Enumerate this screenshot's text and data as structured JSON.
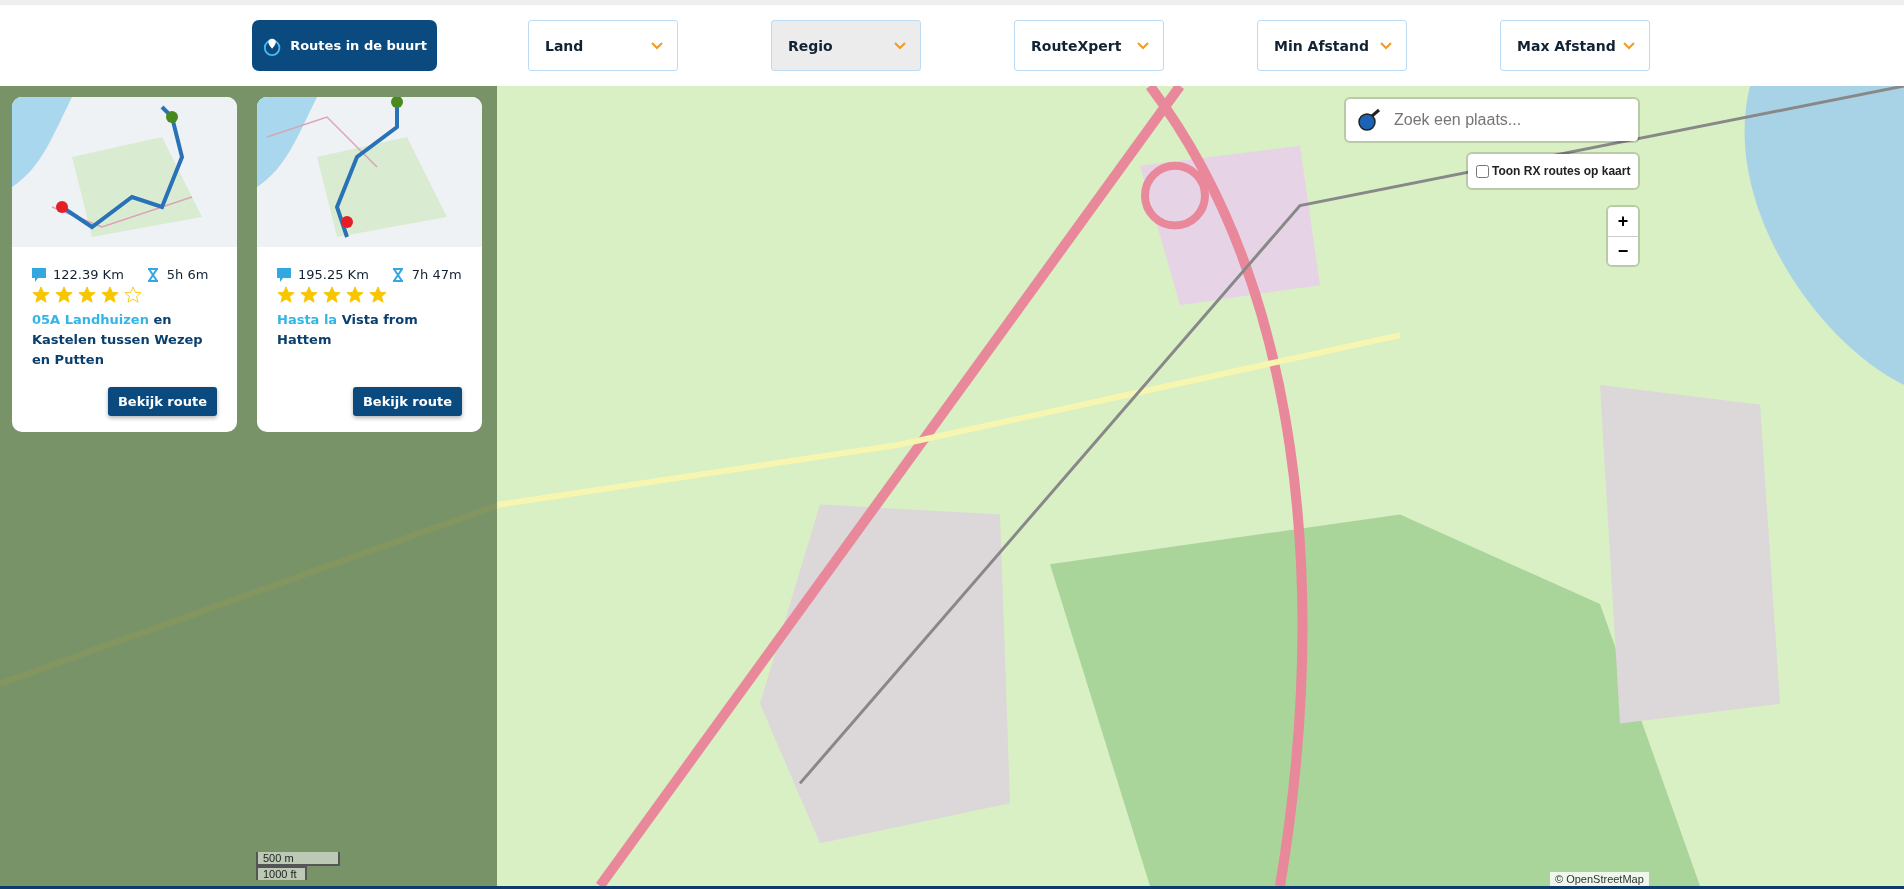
{
  "nearby_button": {
    "label": "Routes in de buurt"
  },
  "filters": [
    {
      "label": "Land",
      "selected": false
    },
    {
      "label": "Regio",
      "selected": true
    },
    {
      "label": "RouteXpert",
      "selected": false
    },
    {
      "label": "Min Afstand",
      "selected": false
    },
    {
      "label": "Max Afstand",
      "selected": false
    }
  ],
  "routes": [
    {
      "distance": "122.39 Km",
      "duration": "5h 6m",
      "stars": 4,
      "title_highlight": "05A Landhuizen",
      "title_rest": "en Kastelen tussen Wezep en Putten",
      "button": "Bekijk route"
    },
    {
      "distance": "195.25 Km",
      "duration": "7h 47m",
      "stars": 5,
      "title_highlight": "Hasta la",
      "title_rest": "Vista from Hattem",
      "button": "Bekijk route"
    }
  ],
  "map": {
    "kind": "picture",
    "search": {
      "placeholder": "Zoek een plaats..."
    },
    "rx_toggle": {
      "label": "Toon RX routes op kaart",
      "checked": false
    },
    "zoom_in": "+",
    "zoom_out": "−",
    "scale": [
      "500 m",
      "1000 ft"
    ],
    "attribution": "© OpenStreetMap"
  }
}
